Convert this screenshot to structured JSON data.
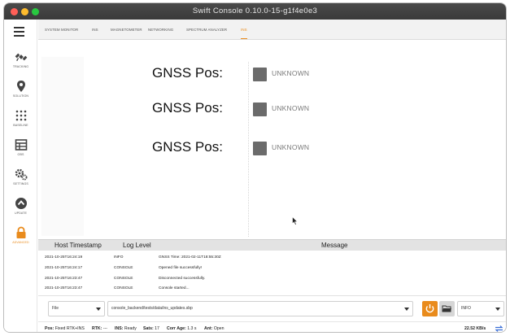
{
  "window": {
    "title": "Swift Console 0.10.0-15-g1f4e0e3"
  },
  "sidebar": {
    "items": [
      {
        "label": "TRACKING",
        "icon": "satellite-icon"
      },
      {
        "label": "SOLUTION",
        "icon": "location-pin-icon"
      },
      {
        "label": "BASELINE",
        "icon": "baseline-dots-icon"
      },
      {
        "label": "OBS",
        "icon": "table-grid-icon"
      },
      {
        "label": "SETTINGS",
        "icon": "gears-icon"
      },
      {
        "label": "UPDATE",
        "icon": "update-arrow-icon"
      },
      {
        "label": "ADVANCED",
        "icon": "lock-icon",
        "active": true
      }
    ]
  },
  "tabs": {
    "items": [
      "SYSTEM MONITOR",
      "INS",
      "MAGNETOMETER",
      "NETWORKING",
      "SPECTRUM ANALYZER",
      "INS"
    ],
    "active_index": 5
  },
  "status": {
    "rows": [
      {
        "label": "GNSS Pos:",
        "value": "UNKNOWN"
      },
      {
        "label": "GNSS Pos:",
        "value": "UNKNOWN"
      },
      {
        "label": "GNSS Pos:",
        "value": "UNKNOWN"
      }
    ]
  },
  "log": {
    "headers": {
      "timestamp": "Host Timestamp",
      "level": "Log Level",
      "message": "Message"
    },
    "rows": [
      {
        "timestamp": "2021-10-25T16:24:19",
        "level": "INFO",
        "message": "GNSS Time: 2021-02-11T18:55:30Z"
      },
      {
        "timestamp": "2021-10-25T16:24:17",
        "level": "CONSOLE",
        "message": "Opened file successfully!"
      },
      {
        "timestamp": "2021-10-25T16:23:47",
        "level": "CONSOLE",
        "message": "Disconnected successfully."
      },
      {
        "timestamp": "2021-10-25T16:23:47",
        "level": "CONSOLE",
        "message": "Console started..."
      }
    ]
  },
  "controls": {
    "source": "File",
    "path": "console_backend/tests/data/ins_updates.sbp",
    "log_level": "INFO"
  },
  "statusbar": {
    "pos_label": "Pos:",
    "pos_value": "Fixed RTK+INS",
    "rtk_label": "RTK:",
    "rtk_value": "---",
    "ins_label": "INS:",
    "ins_value": "Ready",
    "sats_label": "Sats:",
    "sats_value": "17",
    "corr_label": "Corr Age:",
    "corr_value": "1.3 s",
    "ant_label": "Ant:",
    "ant_value": "Open",
    "rate": "22.52 KB/s"
  },
  "colors": {
    "accent": "#e98b1c",
    "status_box": "#6b6b6b",
    "titlebar": "#3f3f3f"
  }
}
